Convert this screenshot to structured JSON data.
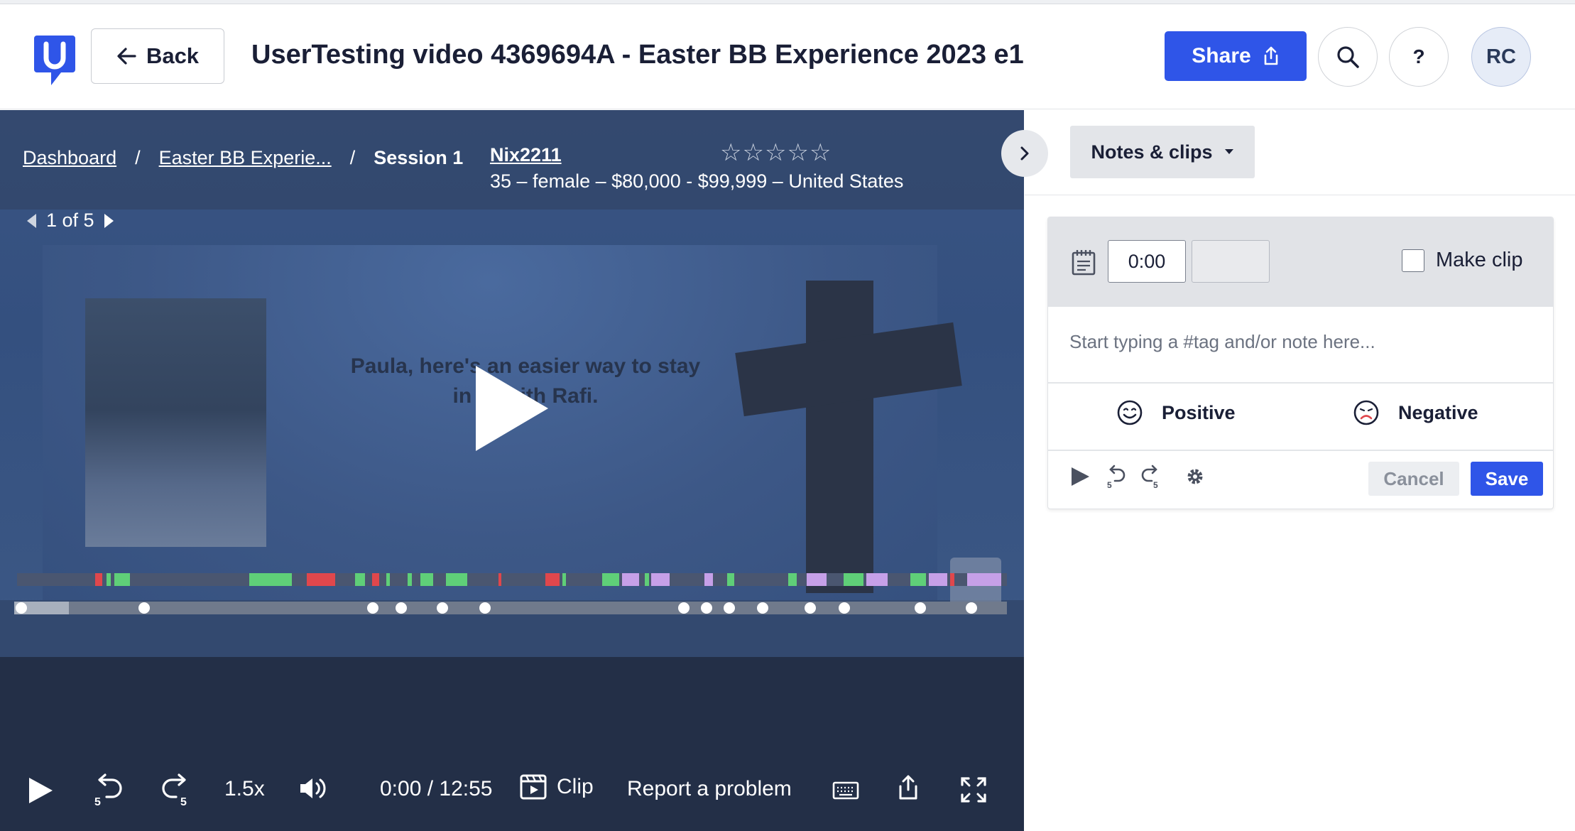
{
  "header": {
    "back_label": "Back",
    "title": "UserTesting video 4369694A - Easter BB Experience 2023 e1",
    "share_label": "Share",
    "help_label": "?",
    "avatar_initials": "RC"
  },
  "breadcrumb": {
    "items": [
      "Dashboard",
      "Easter BB Experie...",
      "Session 1"
    ],
    "separator": "/"
  },
  "participant": {
    "username": "Nix2211",
    "demographics": "35 – female – $80,000 - $99,999 – United States",
    "rating": 0,
    "rating_max": 5
  },
  "video": {
    "pager": "1 of 5",
    "overlay_text": "Paula,  here's an easier way to stay in to    with Rafi.",
    "playback_speed": "1.5x",
    "time": "0:00 / 12:55",
    "clip_label": "Clip",
    "report_label": "Report a problem",
    "progress_fraction": 0.055
  },
  "panel": {
    "notes_dropdown": "Notes & clips",
    "start_time": "0:00",
    "make_clip_label": "Make clip",
    "note_placeholder": "Start typing a #tag and/or note here...",
    "positive_label": "Positive",
    "negative_label": "Negative",
    "cancel_label": "Cancel",
    "save_label": "Save"
  },
  "colors": {
    "accent": "#2f55e8",
    "sentiment_positive": "#5fcf78",
    "sentiment_negative": "#e0474c",
    "sentiment_purple": "#c6a0e8",
    "player_bg": "#232f47"
  }
}
